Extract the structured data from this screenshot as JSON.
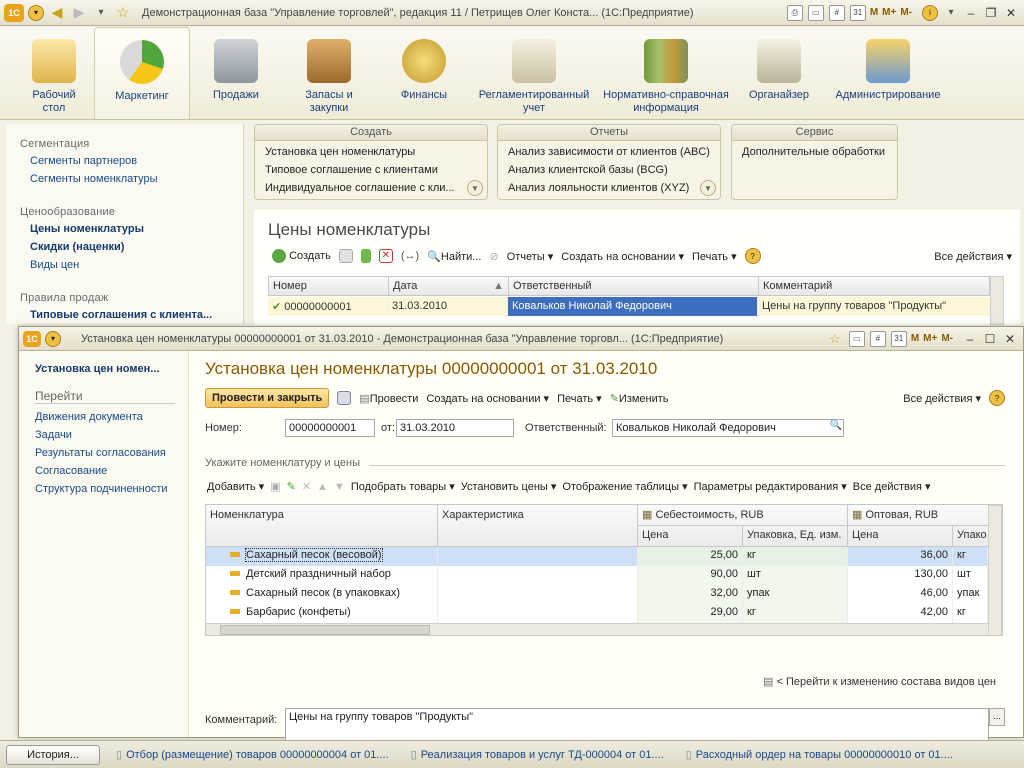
{
  "app": {
    "main_title": "Демонстрационная база \"Управление торговлей\", редакция 11 / Петрищев Олег Конста...  (1С:Предприятие)",
    "m_buttons": [
      "M",
      "M+",
      "M-"
    ],
    "sections": [
      {
        "label": "Рабочий стол",
        "icon": "desk-icon",
        "active": false
      },
      {
        "label": "Маркетинг",
        "icon": "marketing-chart-icon",
        "active": true
      },
      {
        "label": "Продажи",
        "icon": "truck-icon",
        "active": false
      },
      {
        "label": "Запасы и закупки",
        "icon": "boxes-icon",
        "active": false
      },
      {
        "label": "Финансы",
        "icon": "coins-icon",
        "active": false
      },
      {
        "label": "Регламентированный учет",
        "icon": "ledger-icon",
        "active": false
      },
      {
        "label": "Нормативно-справочная информация",
        "icon": "binders-icon",
        "active": false
      },
      {
        "label": "Органайзер",
        "icon": "clipboard-icon",
        "active": false
      },
      {
        "label": "Администрирование",
        "icon": "admin-monitor-icon",
        "active": false
      }
    ]
  },
  "nav": {
    "groups": [
      {
        "title": "Сегментация",
        "items": [
          {
            "label": "Сегменты партнеров",
            "bold": false
          },
          {
            "label": "Сегменты номенклатуры",
            "bold": false
          }
        ]
      },
      {
        "title": "Ценообразование",
        "items": [
          {
            "label": "Цены номенклатуры",
            "bold": true
          },
          {
            "label": "Скидки (наценки)",
            "bold": true
          },
          {
            "label": "Виды цен",
            "bold": false
          }
        ]
      },
      {
        "title": "Правила продаж",
        "items": [
          {
            "label": "Типовые соглашения с клиента...",
            "bold": true
          }
        ]
      }
    ]
  },
  "panels": [
    {
      "title": "Создать",
      "items": [
        "Установка цен номенклатуры",
        "Типовое соглашение с клиентами",
        "Индивидуальное соглашение с кли..."
      ]
    },
    {
      "title": "Отчеты",
      "items": [
        "Анализ зависимости от клиентов (ABC)",
        "Анализ клиентской базы (BCG)",
        "Анализ лояльности клиентов (XYZ)"
      ]
    },
    {
      "title": "Сервис",
      "items": [
        "Дополнительные обработки"
      ]
    }
  ],
  "list": {
    "title": "Цены номенклатуры",
    "toolbar": {
      "create": "Создать",
      "find": "Найти...",
      "reports": "Отчеты",
      "create_based": "Создать на основании",
      "print": "Печать",
      "help": "?",
      "all_actions": "Все действия"
    },
    "columns": [
      "Номер",
      "Дата",
      "Ответственный",
      "Комментарий"
    ],
    "rows": [
      {
        "number": "00000000001",
        "date": "31.03.2010",
        "responsible": "Ковальков Николай Федорович",
        "comment": "Цены на группу товаров \"Продукты\""
      }
    ]
  },
  "doc": {
    "window_title": "Установка цен номенклатуры 00000000001 от 31.03.2010 - Демонстрационная база \"Управление торговл...  (1С:Предприятие)",
    "nav_title": "Установка цен номен...",
    "nav_group": "Перейти",
    "nav_items": [
      "Движения документа",
      "Задачи",
      "Результаты согласования",
      "Согласование",
      "Структура подчиненности"
    ],
    "heading": "Установка цен номенклатуры 00000000001 от 31.03.2010",
    "toolbar": {
      "post_close": "Провести и закрыть",
      "post": "Провести",
      "create_based": "Создать на основании",
      "print": "Печать",
      "edit": "Изменить",
      "all_actions": "Все действия",
      "help": "?"
    },
    "fields": {
      "number_label": "Номер:",
      "number": "00000000001",
      "date_label": "от:",
      "date": "31.03.2010",
      "responsible_label": "Ответственный:",
      "responsible": "Ковальков Николай Федорович"
    },
    "section_label": "Укажите номенклатуру и цены",
    "table_toolbar": {
      "add": "Добавить",
      "pick": "Подобрать товары",
      "set_prices": "Установить цены",
      "display": "Отображение таблицы",
      "params": "Параметры редактирования",
      "all_actions": "Все действия"
    },
    "columns": {
      "item": "Номенклатура",
      "characteristic": "Характеристика",
      "cost_group": "Себестоимость, RUB",
      "wholesale_group": "Оптовая, RUB",
      "price": "Цена",
      "unit": "Упаковка, Ед. изм.",
      "unit_short": "Упако"
    },
    "rows": [
      {
        "item": "Сахарный песок (весовой)",
        "characteristic": "",
        "cost_price": "25,00",
        "cost_unit": "кг",
        "wh_price": "36,00",
        "wh_unit": "кг"
      },
      {
        "item": "Детский праздничный набор",
        "characteristic": "",
        "cost_price": "90,00",
        "cost_unit": "шт",
        "wh_price": "130,00",
        "wh_unit": "шт"
      },
      {
        "item": "Сахарный песок (в упаковках)",
        "characteristic": "",
        "cost_price": "32,00",
        "cost_unit": "упак",
        "wh_price": "46,00",
        "wh_unit": "упак"
      },
      {
        "item": "Барбарис (конфеты)",
        "characteristic": "",
        "cost_price": "29,00",
        "cost_unit": "кг",
        "wh_price": "42,00",
        "wh_unit": "кг"
      }
    ],
    "goto_link": "Перейти к изменению состава видов цен",
    "comment_label": "Комментарий:",
    "comment": "Цены на группу товаров \"Продукты\""
  },
  "statusbar": {
    "history": "История...",
    "tabs": [
      "Отбор (размещение) товаров 00000000004 от 01....",
      "Реализация товаров и услуг ТД-000004 от 01....",
      "Расходный ордер на товары 00000000010 от 01...."
    ]
  }
}
